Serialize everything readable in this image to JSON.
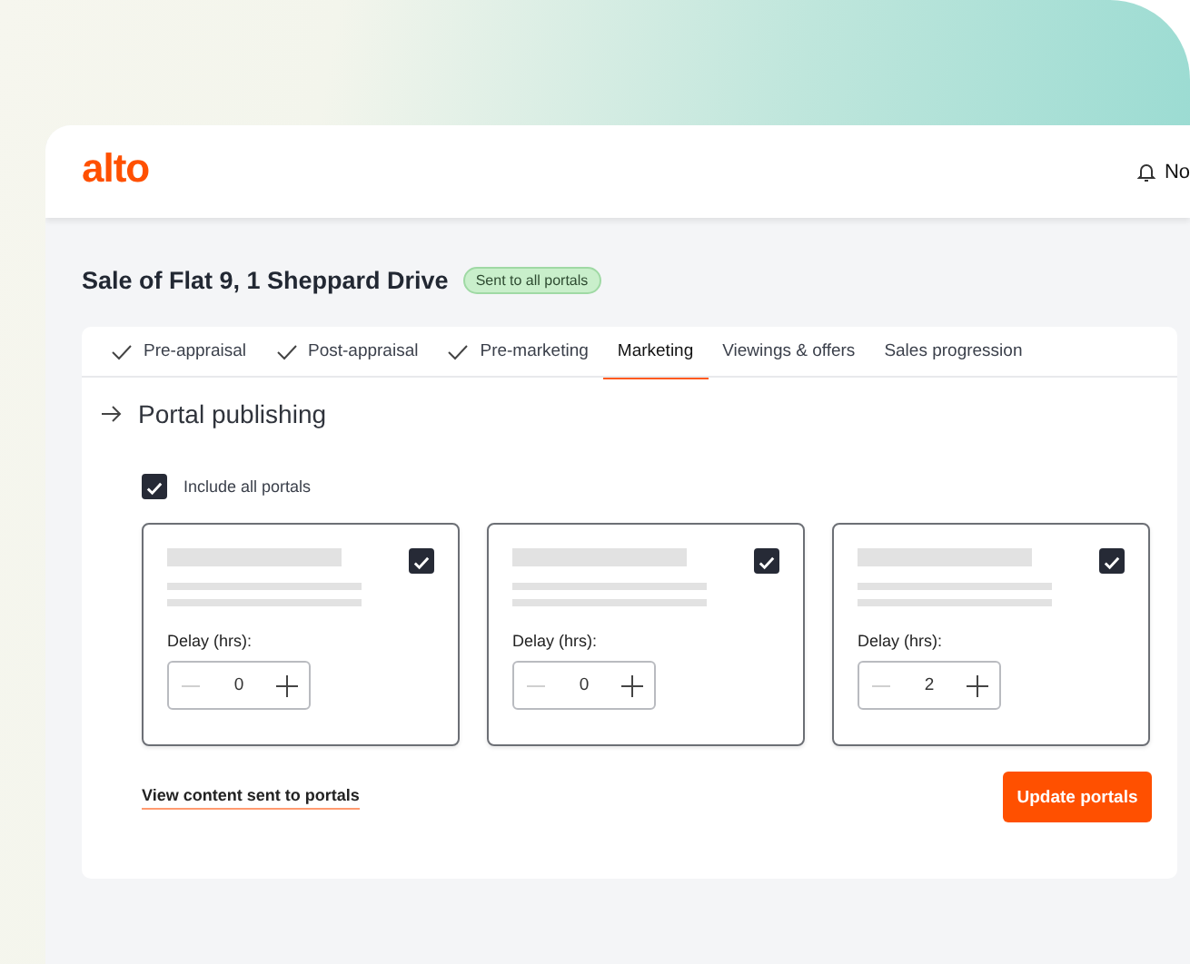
{
  "header": {
    "logo": "alto",
    "notifications_label": "No"
  },
  "page": {
    "title": "Sale of Flat 9, 1 Sheppard Drive",
    "status_badge": "Sent to all portals"
  },
  "tabs": [
    {
      "label": "Pre-appraisal",
      "completed": true,
      "selected": false
    },
    {
      "label": "Post-appraisal",
      "completed": true,
      "selected": false
    },
    {
      "label": "Pre-marketing",
      "completed": true,
      "selected": false
    },
    {
      "label": "Marketing",
      "completed": false,
      "selected": true
    },
    {
      "label": "Viewings & offers",
      "completed": false,
      "selected": false
    },
    {
      "label": "Sales progression",
      "completed": false,
      "selected": false
    }
  ],
  "section": {
    "title": "Portal publishing"
  },
  "include_all": {
    "label": "Include all portals",
    "checked": true
  },
  "portals": [
    {
      "checked": true,
      "delay_label": "Delay (hrs):",
      "delay": "0"
    },
    {
      "checked": true,
      "delay_label": "Delay (hrs):",
      "delay": "0"
    },
    {
      "checked": true,
      "delay_label": "Delay (hrs):",
      "delay": "2"
    }
  ],
  "link": "View content sent to portals",
  "button": "Update portals"
}
